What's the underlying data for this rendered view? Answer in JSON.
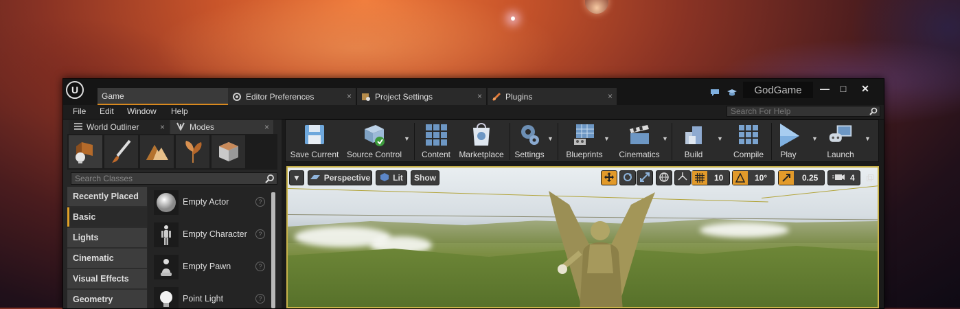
{
  "window": {
    "project_name": "GodGame",
    "tabs": [
      {
        "label": "Game",
        "icon": "level-tab-icon",
        "active": true
      },
      {
        "label": "Editor Preferences",
        "icon": "editor-preferences-icon"
      },
      {
        "label": "Project Settings",
        "icon": "project-settings-icon"
      },
      {
        "label": "Plugins",
        "icon": "plugins-icon"
      }
    ],
    "close_glyph": "×",
    "minimize_glyph": "—",
    "maximize_glyph": "□",
    "exit_glyph": "✕"
  },
  "menu": {
    "items": [
      "File",
      "Edit",
      "Window",
      "Help"
    ],
    "help_search_placeholder": "Search For Help"
  },
  "left_panel": {
    "tabs": [
      {
        "label": "World Outliner"
      },
      {
        "label": "Modes"
      }
    ],
    "modes": [
      "place-mode-icon",
      "paint-mode-icon",
      "landscape-mode-icon",
      "foliage-mode-icon",
      "mesh-paint-mode-icon"
    ],
    "search_placeholder": "Search Classes",
    "categories": [
      "Recently Placed",
      "Basic",
      "Lights",
      "Cinematic",
      "Visual Effects",
      "Geometry"
    ],
    "selected_category": "Basic",
    "items": [
      {
        "label": "Empty Actor",
        "icon": "sphere-icon"
      },
      {
        "label": "Empty Character",
        "icon": "mannequin-icon"
      },
      {
        "label": "Empty Pawn",
        "icon": "pawn-icon"
      },
      {
        "label": "Point Light",
        "icon": "lightbulb-icon"
      }
    ],
    "help_glyph": "?"
  },
  "toolbar": {
    "buttons": [
      {
        "label": "Save Current",
        "icon": "save-icon"
      },
      {
        "label": "Source Control",
        "icon": "source-control-icon"
      },
      {
        "label": "Content",
        "icon": "content-browser-icon"
      },
      {
        "label": "Marketplace",
        "icon": "marketplace-icon"
      },
      {
        "label": "Settings",
        "icon": "settings-gear-icon"
      },
      {
        "label": "Blueprints",
        "icon": "blueprints-icon"
      },
      {
        "label": "Cinematics",
        "icon": "cinematics-clapper-icon"
      },
      {
        "label": "Build",
        "icon": "build-icon"
      },
      {
        "label": "Compile",
        "icon": "compile-icon"
      },
      {
        "label": "Play",
        "icon": "play-icon"
      },
      {
        "label": "Launch",
        "icon": "launch-icon"
      }
    ]
  },
  "viewport": {
    "view_mode_label": "Perspective",
    "lighting_label": "Lit",
    "show_label": "Show",
    "grid_snap_value": "10",
    "rotation_snap_value": "10°",
    "scale_snap_value": "0.25",
    "camera_speed_value": "4"
  },
  "colors": {
    "accent": "#e29a2a",
    "selection_outline": "#c9b34a",
    "panel_bg": "#262626"
  }
}
